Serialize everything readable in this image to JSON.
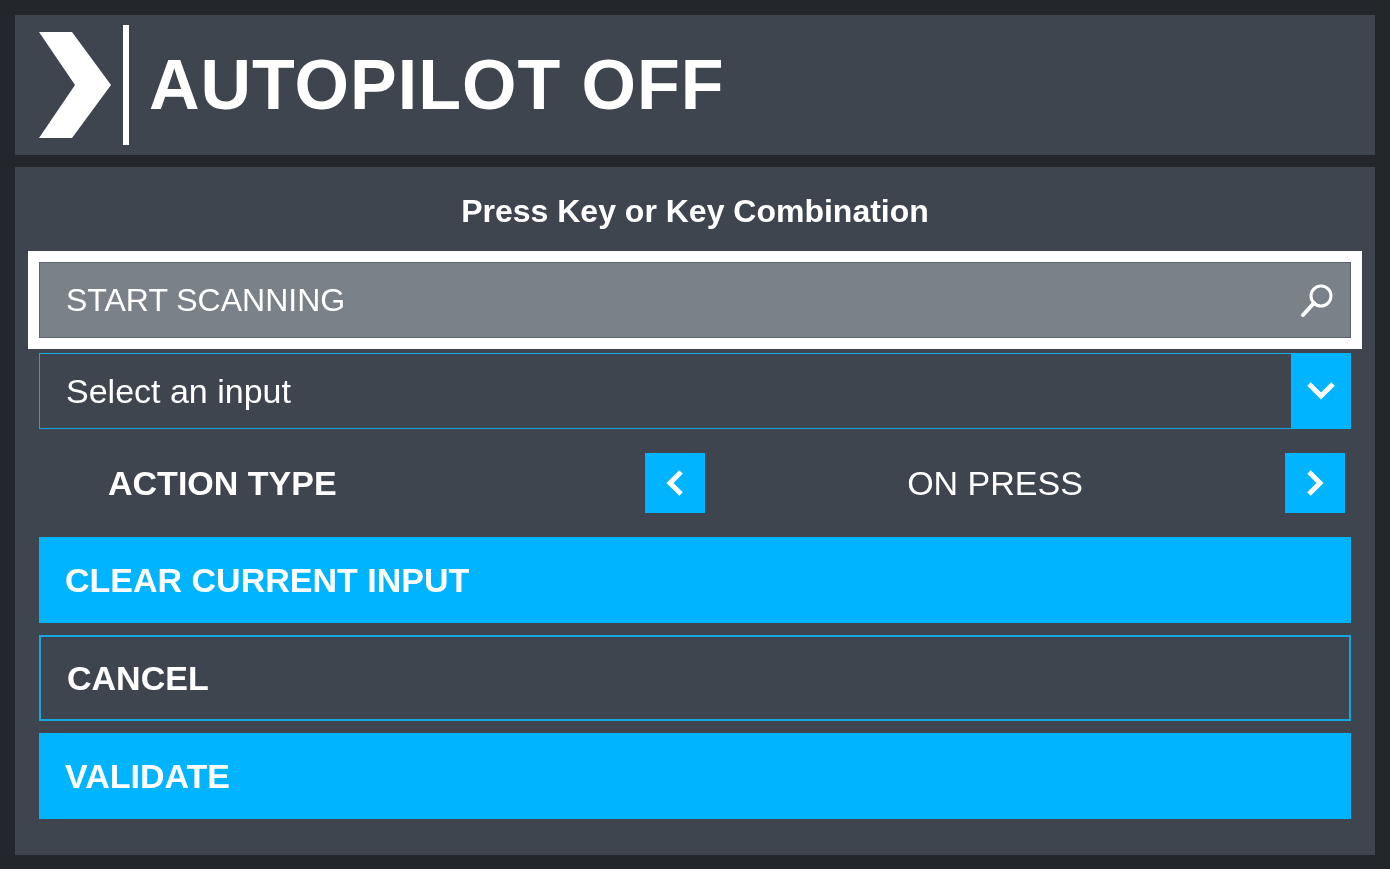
{
  "header": {
    "title": "AUTOPILOT OFF"
  },
  "prompt": "Press Key or Key Combination",
  "scan_field": {
    "label": "START SCANNING",
    "focused": true
  },
  "input_select": {
    "placeholder": "Select an input"
  },
  "action_type": {
    "label": "ACTION TYPE",
    "value": "ON PRESS"
  },
  "buttons": [
    {
      "label": "CLEAR CURRENT INPUT",
      "kind": "filled"
    },
    {
      "label": "CANCEL",
      "kind": "outline"
    },
    {
      "label": "VALIDATE",
      "kind": "filled"
    }
  ]
}
